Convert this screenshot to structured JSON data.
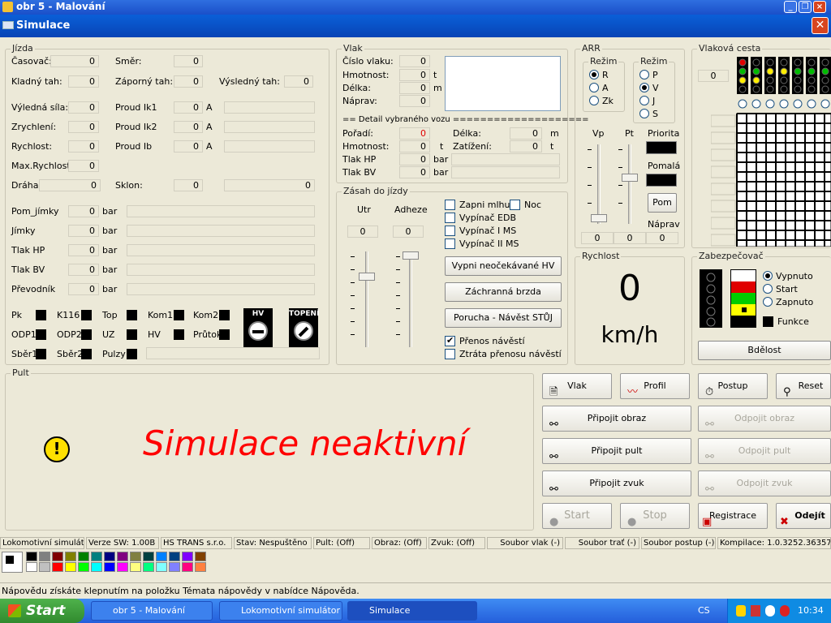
{
  "paint_title": "obr 5 - Malování",
  "sim_title": "Simulace",
  "jizda": {
    "title": "Jízda",
    "casovac_l": "Časovač:",
    "casovac": "0",
    "smer_l": "Směr:",
    "smer": "0",
    "kladny_l": "Kladný tah:",
    "kladny": "0",
    "zaporny_l": "Záporný tah:",
    "zaporny": "0",
    "vysledny_l": "Výsledný tah:",
    "vysledny": "0",
    "sila_l": "Výledná síla:",
    "sila": "0",
    "ik1_l": "Proud Ik1",
    "ik1": "0",
    "zrych_l": "Zrychlení:",
    "zrych": "0",
    "ik2_l": "Proud Ik2",
    "ik2": "0",
    "rych_l": "Rychlost:",
    "rych": "0",
    "ib_l": "Proud Ib",
    "ib": "0",
    "amp": "A",
    "maxr_l": "Max.Rychlost:",
    "maxr": "0",
    "draha_l": "Dráha:",
    "draha": "0",
    "sklon_l": "Sklon:",
    "sklon": "0",
    "sklon_bar": "0",
    "pomj_l": "Pom_jímky",
    "pomj": "0",
    "jimky_l": "Jímky",
    "jimky": "0",
    "thp_l": "Tlak HP",
    "thp": "0",
    "tbv_l": "Tlak BV",
    "tbv": "0",
    "prev_l": "Převodník",
    "prev": "0",
    "bar": "bar",
    "ind": [
      "Pk",
      "K116",
      "Top",
      "Kom1",
      "Kom2",
      "ODP1",
      "ODP2",
      "UZ",
      "HV",
      "Průtok",
      "Sběr1",
      "Sběr2",
      "Pulzy"
    ],
    "hv_label": "HV",
    "topeni_label": "TOPENÍ"
  },
  "vlak": {
    "title": "Vlak",
    "cislo_l": "Číslo vlaku:",
    "cislo": "0",
    "hmot_l": "Hmotnost:",
    "hmot": "0",
    "t": "t",
    "delka_l": "Délka:",
    "delka": "0",
    "m": "m",
    "naprav_l": "Náprav:",
    "naprav": "0",
    "detail": "== Detail vybraného vozu ====================",
    "poradi_l": "Pořadí:",
    "poradi": "0",
    "ddelka_l": "Délka:",
    "ddelka": "0",
    "dhmot_l": "Hmotnost:",
    "dhmot": "0",
    "zatiz_l": "Zatížení:",
    "zatiz": "0",
    "dthp_l": "Tlak HP",
    "dthp": "0",
    "dtbv_l": "Tlak BV",
    "dtbv": "0",
    "bar": "bar"
  },
  "zasah": {
    "title": "Zásah do jízdy",
    "utr_l": "Utr",
    "utr": "0",
    "adh_l": "Adheze",
    "adh": "0",
    "mlha": "Zapni mlhu",
    "noc": "Noc",
    "edb": "Vypínač EDB",
    "ms1": "Vypínač I MS",
    "ms2": "Vypínač II MS",
    "btn_hv": "Vypni neočekávané HV",
    "btn_brzda": "Záchranná brzda",
    "btn_porucha": "Porucha - Návěst STŮJ",
    "prenos": "Přenos návěstí",
    "ztrata": "Ztráta přenosu návěstí"
  },
  "arr": {
    "title": "ARR",
    "rezim1": "Režim",
    "r1": [
      "R",
      "A",
      "Zk"
    ],
    "rezim2": "Režim",
    "r2": [
      "P",
      "V",
      "J",
      "S"
    ],
    "vp": "Vp",
    "pt": "Pt",
    "priorita": "Priorita",
    "pomala": "Pomalá",
    "pom": "Pom",
    "naprav": "Náprav",
    "v1": "0",
    "v2": "0",
    "v3": "0"
  },
  "cesta": {
    "title": "Vlaková cesta",
    "val": "0"
  },
  "rychlost": {
    "title": "Rychlost",
    "value": "0",
    "unit": "km/h"
  },
  "zabez": {
    "title": "Zabezpečovač",
    "opts": [
      "Vypnuto",
      "Start",
      "Zapnuto"
    ],
    "funkce": "Funkce",
    "bdelost": "Bdělost"
  },
  "pult": {
    "title": "Pult",
    "message": "Simulace neaktivní"
  },
  "buttons": {
    "vlak": "Vlak",
    "profil": "Profil",
    "postup": "Postup",
    "reset": "Reset",
    "pripojit_obraz": "Připojit obraz",
    "odpojit_obraz": "Odpojit obraz",
    "pripojit_pult": "Připojit pult",
    "odpojit_pult": "Odpojit pult",
    "pripojit_zvuk": "Připojit zvuk",
    "odpojit_zvuk": "Odpojit zvuk",
    "start": "Start",
    "stop": "Stop",
    "registrace": "Registrace",
    "odejit": "Odejít"
  },
  "status": [
    "Lokomotivní simulátor",
    "Verze SW: 1.00B",
    "HS TRANS s.r.o.",
    "Stav: Nespuštěno",
    "Pult: (Off)",
    "Obraz: (Off)",
    "Zvuk: (Off)",
    "Soubor vlak (-)",
    "Soubor trať (-)",
    "Soubor postup (-)",
    "Kompilace: 1.0.3252.36357"
  ],
  "paint_help": "Nápovědu získáte klepnutím na položku Témata nápovědy v nabídce Nápověda.",
  "taskbar": {
    "start": "Start",
    "items": [
      "obr 5 - Malování",
      "Lokomotivní simulátor",
      "Simulace"
    ],
    "lang": "CS",
    "clock": "10:34"
  },
  "colors": {
    "title_blue": "#0a5fd8",
    "taskbar_blue": "#245edb",
    "start_green": "#3c9a38",
    "message_red": "#ff0000"
  }
}
